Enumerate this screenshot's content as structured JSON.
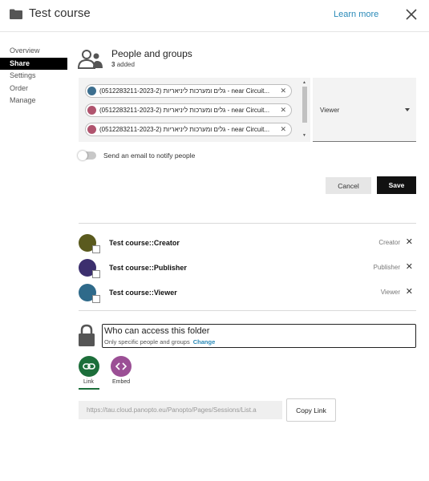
{
  "header": {
    "title": "Test course",
    "learn_more": "Learn more"
  },
  "sidebar": {
    "items": [
      {
        "label": "Overview",
        "active": false
      },
      {
        "label": "Share",
        "active": true
      },
      {
        "label": "Settings",
        "active": false
      },
      {
        "label": "Order",
        "active": false
      },
      {
        "label": "Manage",
        "active": false
      }
    ]
  },
  "people": {
    "title": "People and groups",
    "count": "3",
    "count_suffix": "added",
    "chips": [
      {
        "text": "(0512283211-2023-2) גלים ומערכות ליניאריות - near Circuit...",
        "avatar_color": "#3d6f8f"
      },
      {
        "text": "(0512283211-2023-2) גלים ומערכות ליניאריות - near Circuit...",
        "avatar_color": "#b0546e"
      },
      {
        "text": "(0512283211-2023-2) גלים ומערכות ליניאריות - near Circuit...",
        "avatar_color": "#b0546e"
      }
    ],
    "role": "Viewer"
  },
  "notify": {
    "label": "Send an email to notify people",
    "enabled": false
  },
  "actions": {
    "cancel": "Cancel",
    "save": "Save"
  },
  "groups": [
    {
      "name": "Test course::Creator",
      "role": "Creator",
      "color": "#5a5a1e"
    },
    {
      "name": "Test course::Publisher",
      "role": "Publisher",
      "color": "#3c2f6e"
    },
    {
      "name": "Test course::Viewer",
      "role": "Viewer",
      "color": "#2f6a8a"
    }
  ],
  "access": {
    "title": "Who can access this folder",
    "subtitle": "Only specific people and groups",
    "change": "Change"
  },
  "share_options": [
    {
      "label": "Link",
      "color": "#1c6e3a"
    },
    {
      "label": "Embed",
      "color": "#9b4f95"
    }
  ],
  "link": {
    "url": "https://tau.cloud.panopto.eu/Panopto/Pages/Sessions/List.a",
    "copy": "Copy Link"
  },
  "icons": {
    "folder": "folder-icon",
    "close": "close-icon",
    "people": "people-icon",
    "lock": "lock-icon",
    "link": "link-icon",
    "embed": "embed-icon"
  }
}
